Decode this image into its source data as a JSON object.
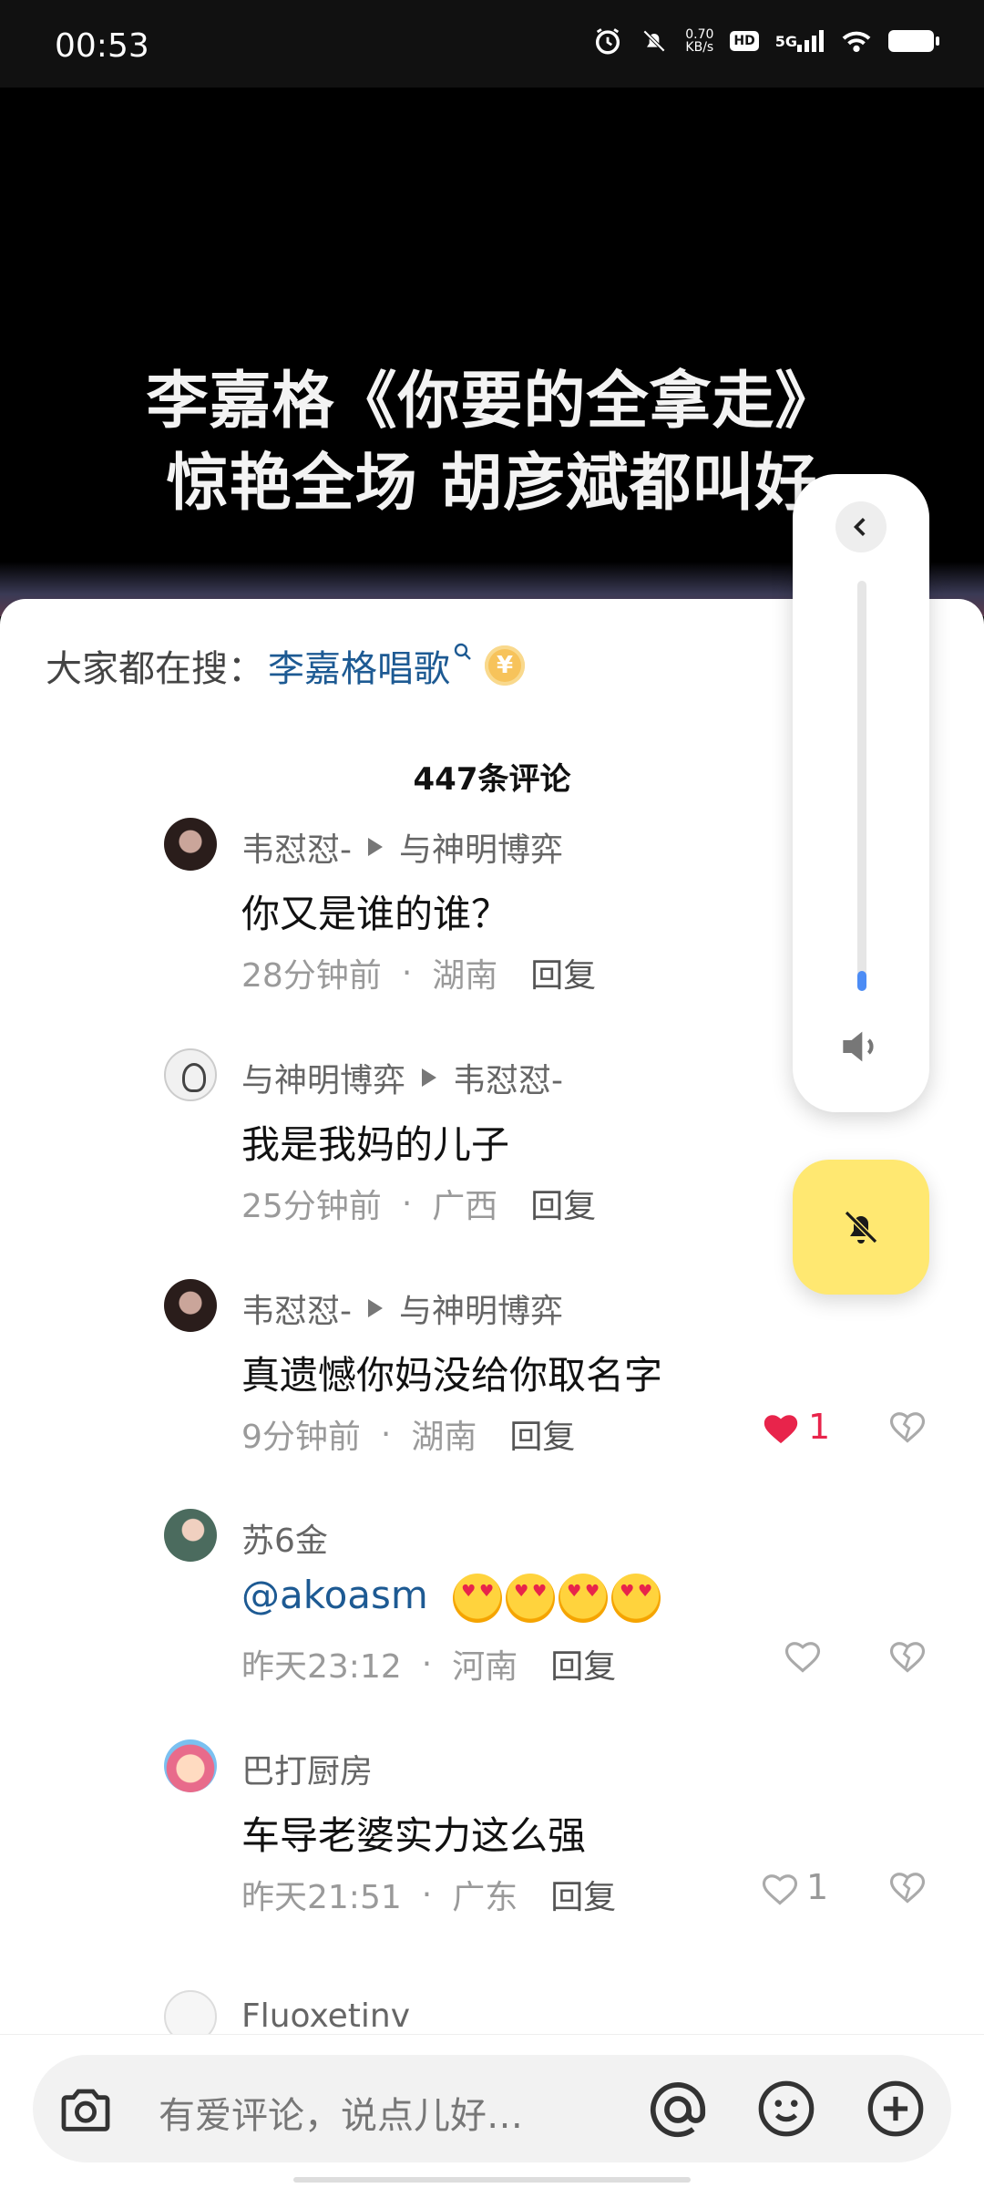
{
  "status_bar": {
    "time": "00:53",
    "net_speed_value": "0.70",
    "net_speed_unit": "KB/s",
    "hd": "HD",
    "net_type": "5G"
  },
  "video": {
    "caption_line1": "李嘉格《你要的全拿走》",
    "caption_line2": "惊艳全场 胡彦斌都叫好"
  },
  "search": {
    "prefix": "大家都在搜：",
    "term": "李嘉格唱歌",
    "coin": "¥"
  },
  "comment_count": "447条评论",
  "comments": [
    {
      "author": "韦怼怼-",
      "reply_to": "与神明博弈",
      "text": "你又是谁的谁？",
      "time": "28分钟前",
      "location": "湖南",
      "reply": "回复"
    },
    {
      "author": "与神明博弈",
      "reply_to": "韦怼怼-",
      "text": "我是我妈的儿子",
      "time": "25分钟前",
      "location": "广西",
      "reply": "回复"
    },
    {
      "author": "韦怼怼-",
      "reply_to": "与神明博弈",
      "text": "真遗憾你妈没给你取名字",
      "time": "9分钟前",
      "location": "湖南",
      "reply": "回复",
      "likes": "1"
    },
    {
      "author": "苏6金",
      "text": "@akoasm",
      "time": "昨天23:12",
      "location": "河南",
      "reply": "回复"
    },
    {
      "author": "巴打厨房",
      "text": "车导老婆实力这么强",
      "time": "昨天21:51",
      "location": "广东",
      "reply": "回复",
      "likes": "1"
    },
    {
      "author": "Fluoxetinv"
    }
  ],
  "input": {
    "placeholder": "有爱评论，说点儿好…"
  },
  "volume": {
    "level": 0.05
  },
  "colors": {
    "accent_link": "#1d5a93",
    "like_red": "#e8244b",
    "volume_blue": "#4c8cf5",
    "mute_fab_yellow": "#ffe871"
  }
}
